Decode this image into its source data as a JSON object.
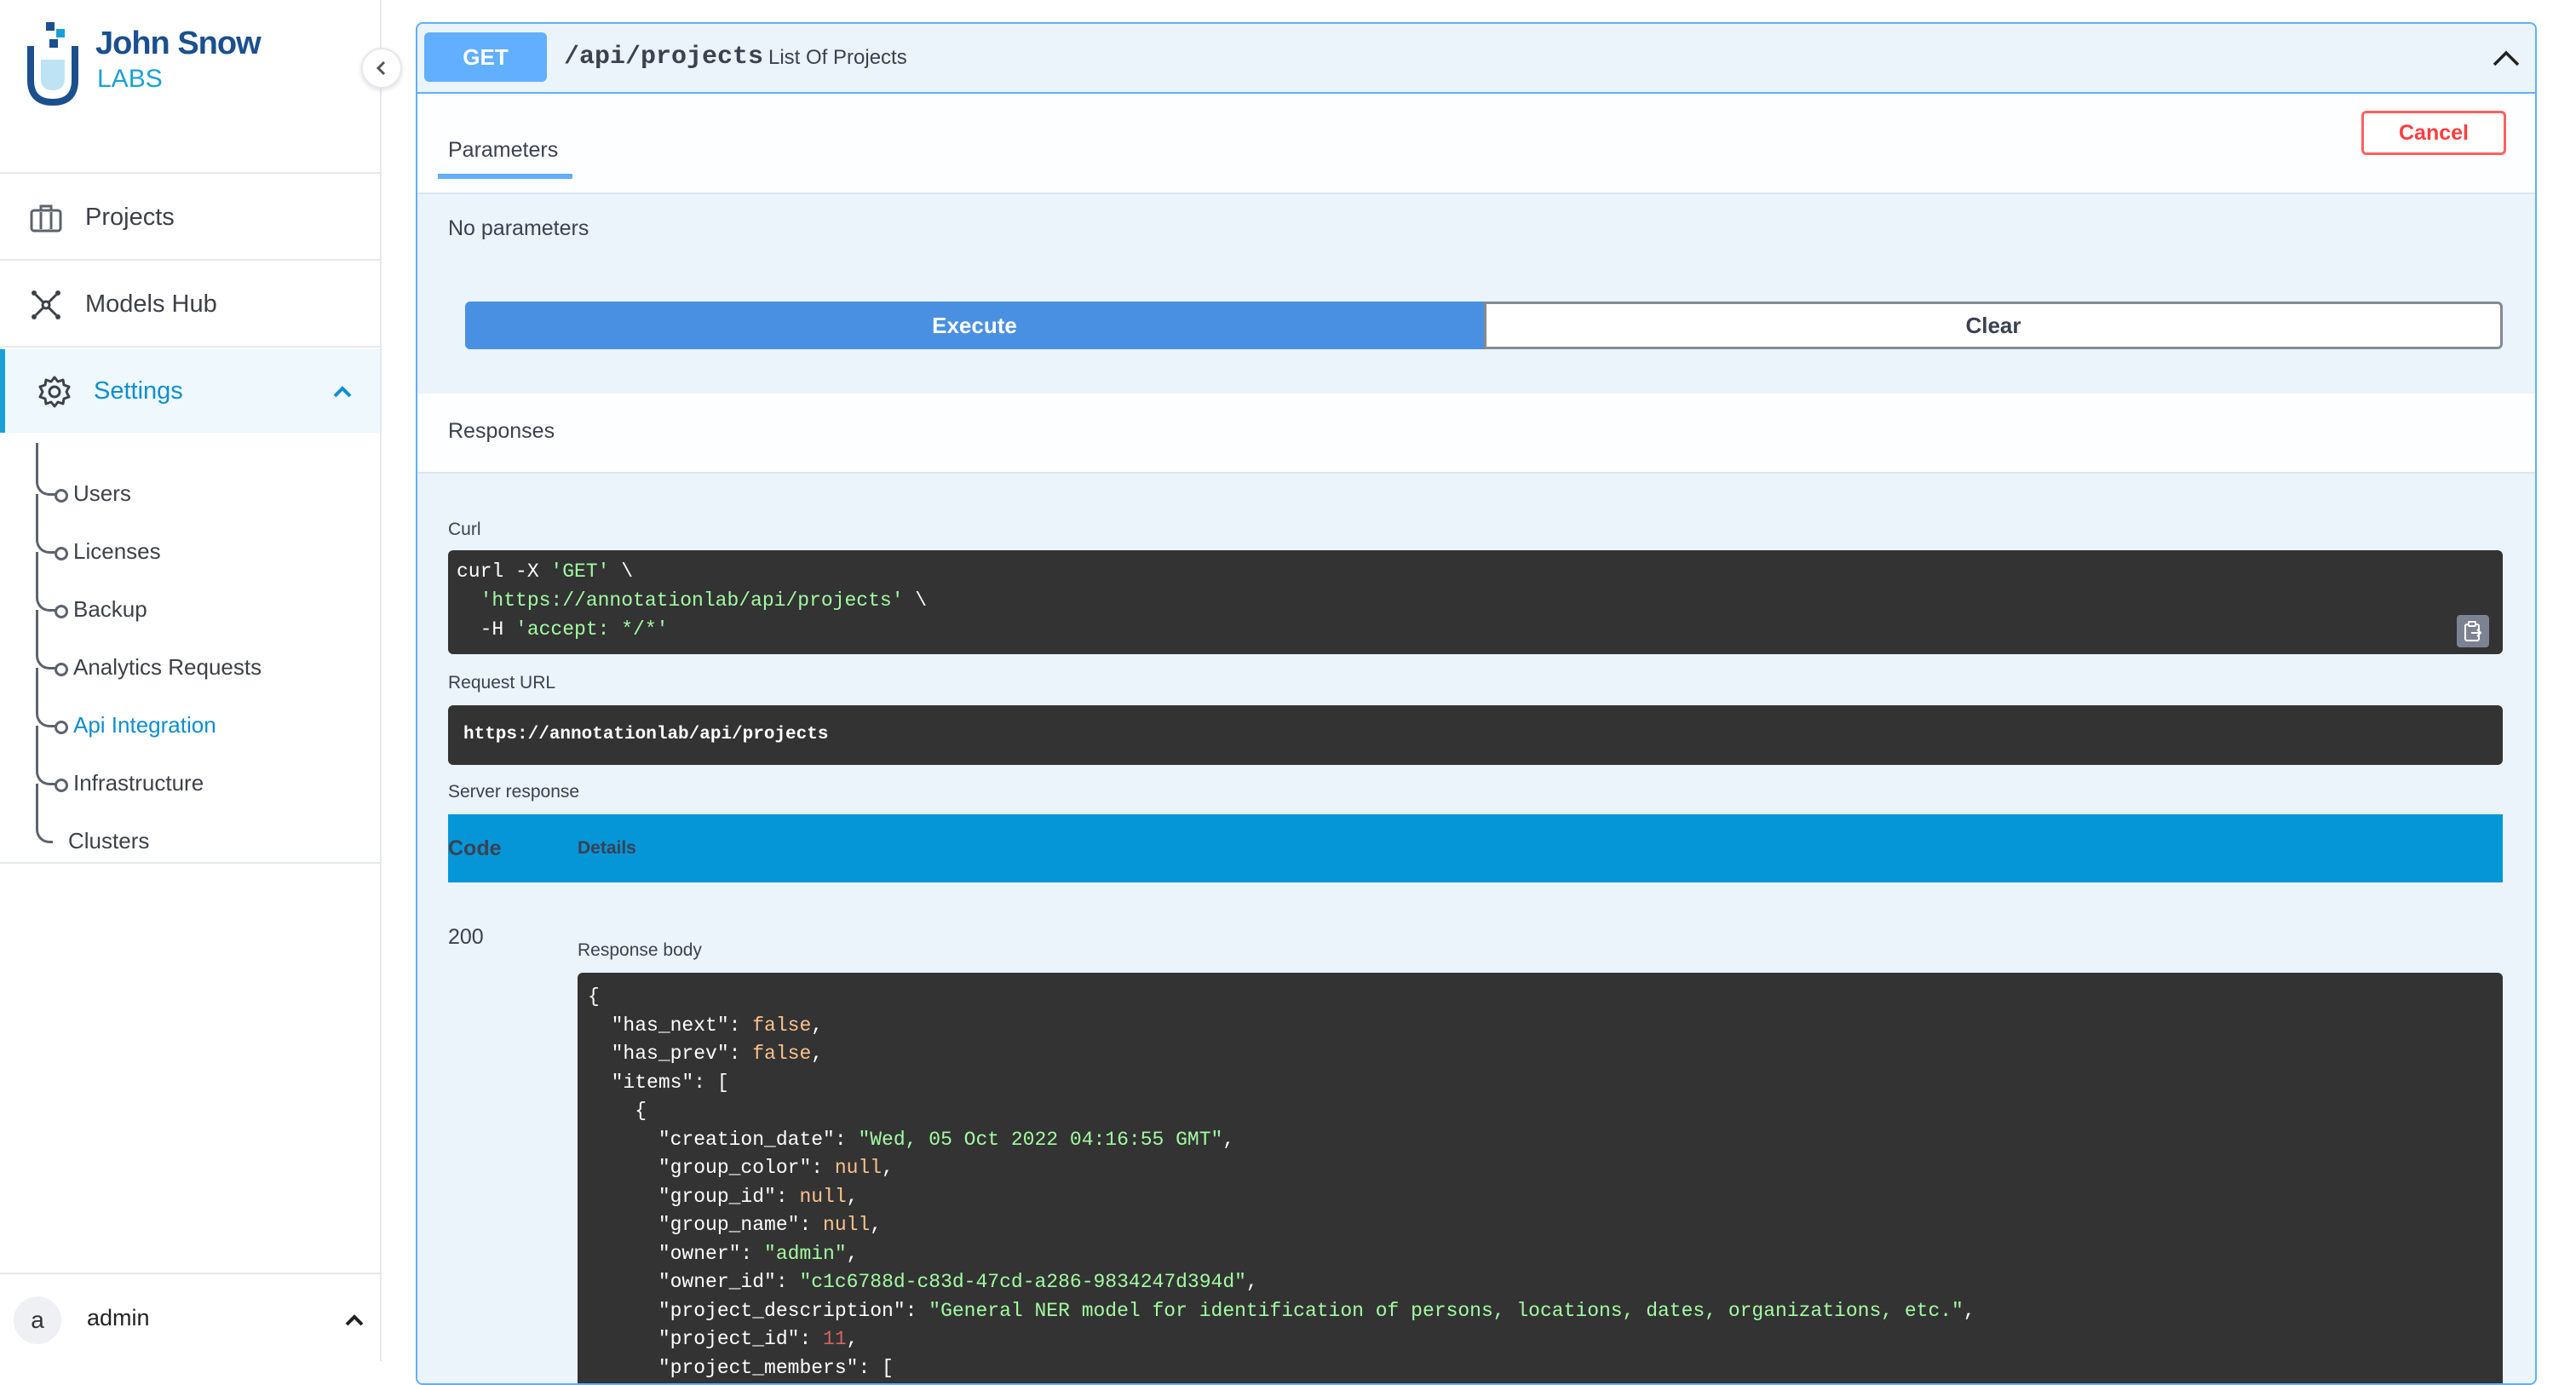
{
  "brand": {
    "line1": "John Snow",
    "line2": "LABS"
  },
  "sidebar": {
    "nav": [
      {
        "label": "Projects",
        "icon": "briefcase-icon"
      },
      {
        "label": "Models Hub",
        "icon": "network-icon"
      },
      {
        "label": "Settings",
        "icon": "gear-icon"
      }
    ],
    "sub_items": [
      "Users",
      "Licenses",
      "Backup",
      "Analytics Requests",
      "Api Integration",
      "Infrastructure",
      "Clusters"
    ],
    "active_sub": "Api Integration",
    "user": {
      "avatar": "a",
      "name": "admin"
    }
  },
  "operation": {
    "method": "GET",
    "path": "/api/projects",
    "description": "List Of Projects",
    "tab": "Parameters",
    "cancel": "Cancel",
    "no_params": "No parameters",
    "execute": "Execute",
    "clear": "Clear",
    "responses": "Responses",
    "curl_label": "Curl",
    "curl": {
      "l1_cmd": "curl -X ",
      "l1_str": "'GET'",
      "l1_end": " \\",
      "l2_str": "'https://annotationlab/api/projects'",
      "l2_end": " \\",
      "l3_cmd": "  -H ",
      "l3_str": "'accept: */*'"
    },
    "request_url_label": "Request URL",
    "request_url": "https://annotationlab/api/projects",
    "server_response_label": "Server response",
    "col_code": "Code",
    "col_details": "Details",
    "status": "200",
    "response_body_label": "Response body",
    "body": {
      "has_next": "false",
      "has_prev": "false",
      "creation_date": "\"Wed, 05 Oct 2022 04:16:55 GMT\"",
      "group_color": "null",
      "group_id": "null",
      "group_name": "null",
      "owner": "\"admin\"",
      "owner_id": "\"c1c6788d-c83d-47cd-a286-9834247d394d\"",
      "project_description": "\"General NER model for identification of persons, locations, dates, organizations, etc.\"",
      "project_id": "11"
    }
  }
}
